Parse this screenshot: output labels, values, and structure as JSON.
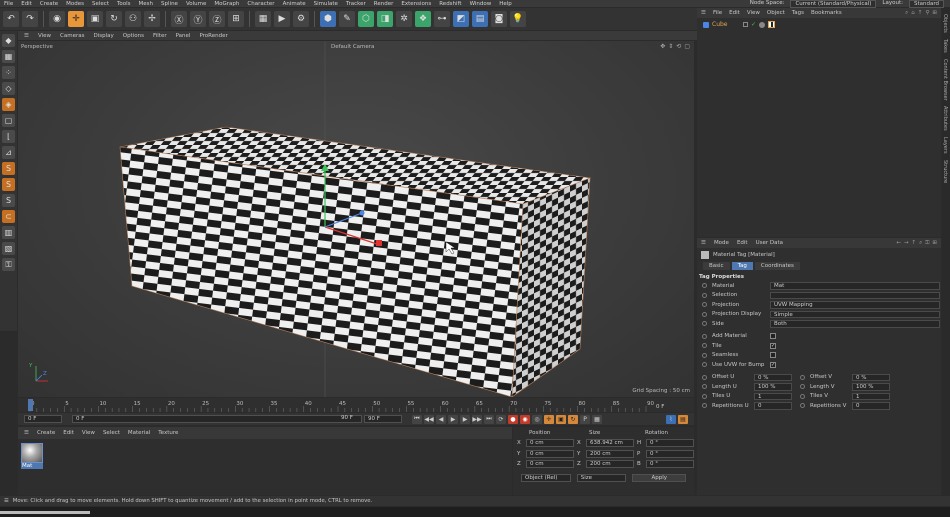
{
  "menubar": {
    "items": [
      "File",
      "Edit",
      "Create",
      "Modes",
      "Select",
      "Tools",
      "Mesh",
      "Spline",
      "Volume",
      "MoGraph",
      "Character",
      "Animate",
      "Simulate",
      "Tracker",
      "Render",
      "Extensions",
      "Redshift",
      "Window",
      "Help"
    ],
    "node_space_label": "Node Space:",
    "node_space_value": "Current (Standard/Physical)",
    "layout_label": "Layout:",
    "layout_value": "Standard"
  },
  "viewport": {
    "menu": [
      "View",
      "Cameras",
      "Display",
      "Options",
      "Filter",
      "Panel",
      "ProRender"
    ],
    "view_name": "Perspective",
    "camera": "Default Camera",
    "grid_spacing": "Grid Spacing : 50 cm",
    "axis_y": "Y",
    "axis_z": "Z"
  },
  "timeline": {
    "ticks": [
      "0",
      "5",
      "10",
      "15",
      "20",
      "25",
      "30",
      "35",
      "40",
      "45",
      "50",
      "55",
      "60",
      "65",
      "70",
      "75",
      "80",
      "85",
      "90"
    ],
    "end_frame": "0 F"
  },
  "playbar": {
    "start": "0 F",
    "current": "0 F",
    "mid": "90 F",
    "end": "90 F"
  },
  "materials": {
    "menu": [
      "Create",
      "Edit",
      "View",
      "Select",
      "Material",
      "Texture"
    ],
    "items": [
      {
        "name": "Mat"
      }
    ]
  },
  "coords": {
    "headers": [
      "Position",
      "Size",
      "Rotation"
    ],
    "rows": [
      {
        "axis": "X",
        "pos": "0 cm",
        "size_axis": "X",
        "size": "638.942 cm",
        "rot_axis": "H",
        "rot": "0 °"
      },
      {
        "axis": "Y",
        "pos": "0 cm",
        "size_axis": "Y",
        "size": "200 cm",
        "rot_axis": "P",
        "rot": "0 °"
      },
      {
        "axis": "Z",
        "pos": "0 cm",
        "size_axis": "Z",
        "size": "200 cm",
        "rot_axis": "B",
        "rot": "0 °"
      }
    ],
    "mode": "Object (Rel)",
    "size_mode": "Size",
    "apply": "Apply"
  },
  "status": {
    "text": "Move: Click and drag to move elements. Hold down SHIFT to quantize movement / add to the selection in point mode, CTRL to remove."
  },
  "objects": {
    "menu": [
      "File",
      "Edit",
      "View",
      "Object",
      "Tags",
      "Bookmarks"
    ],
    "items": [
      {
        "name": "Cube"
      }
    ]
  },
  "attributes": {
    "menu": [
      "Mode",
      "Edit",
      "User Data"
    ],
    "title": "Material Tag [Material]",
    "tabs": [
      "Basic",
      "Tag",
      "Coordinates"
    ],
    "active_tab": "Tag",
    "section": "Tag Properties",
    "props": [
      {
        "label": "Material",
        "value": "Mat"
      },
      {
        "label": "Selection",
        "value": ""
      },
      {
        "label": "Projection",
        "value": "UVW Mapping"
      },
      {
        "label": "Projection Display",
        "value": "Simple"
      },
      {
        "label": "Side",
        "value": "Both"
      }
    ],
    "checks": [
      {
        "label": "Add Material",
        "checked": false
      },
      {
        "label": "Tile",
        "checked": true
      },
      {
        "label": "Seamless",
        "checked": false
      },
      {
        "label": "Use UVW for Bump",
        "checked": true
      }
    ],
    "offsets": [
      {
        "l1": "Offset U",
        "v1": "0 %",
        "l2": "Offset V",
        "v2": "0 %"
      },
      {
        "l1": "Length U",
        "v1": "100 %",
        "l2": "Length V",
        "v2": "100 %"
      },
      {
        "l1": "Tiles U",
        "v1": "1",
        "l2": "Tiles V",
        "v2": "1"
      },
      {
        "l1": "Repetitions U",
        "v1": "0",
        "l2": "Repetitions V",
        "v2": "0"
      }
    ]
  },
  "right_tabs": [
    "Objects",
    "Takes",
    "Content Browser",
    "Attributes",
    "Layers",
    "Structure"
  ],
  "colors": {
    "accent": "#4f78b0",
    "orange": "#e8963a",
    "panel": "#2f2f2f"
  }
}
